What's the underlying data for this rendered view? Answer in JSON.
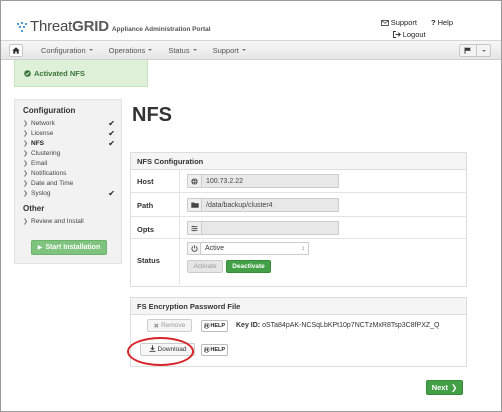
{
  "app": {
    "logo_text_light": "Threat",
    "logo_text_bold": "GRID",
    "subtitle": "Appliance Administration Portal"
  },
  "top_links": {
    "support": "Support",
    "help": "Help",
    "logout": "Logout"
  },
  "navbar": {
    "menus": [
      "Configuration",
      "Operations",
      "Status",
      "Support"
    ]
  },
  "alert": {
    "text": "Activated NFS",
    "color": "#dff0d8"
  },
  "sidebar": {
    "config_heading": "Configuration",
    "items": [
      {
        "label": "Network",
        "checked": true,
        "active": false
      },
      {
        "label": "License",
        "checked": true,
        "active": false
      },
      {
        "label": "NFS",
        "checked": true,
        "active": true
      },
      {
        "label": "Clustering",
        "checked": false,
        "active": false
      },
      {
        "label": "Email",
        "checked": false,
        "active": false
      },
      {
        "label": "Notifications",
        "checked": false,
        "active": false
      },
      {
        "label": "Date and Time",
        "checked": false,
        "active": false
      },
      {
        "label": "Syslog",
        "checked": true,
        "active": false
      }
    ],
    "other_heading": "Other",
    "other_items": [
      {
        "label": "Review and Install"
      }
    ],
    "start_button": "Start Installation"
  },
  "main": {
    "title": "NFS",
    "nfs_panel": {
      "heading": "NFS Configuration",
      "host_label": "Host",
      "host_value": "100.73.2.22",
      "path_label": "Path",
      "path_value": "/data/backup/cluster4",
      "opts_label": "Opts",
      "opts_value": "",
      "status_label": "Status",
      "status_value": "Active",
      "activate_label": "Activate",
      "deactivate_label": "Deactivate"
    },
    "fs_panel": {
      "heading": "FS Encryption Password File",
      "remove_label": "Remove",
      "help_label": "HELP",
      "key_id_label": "Key ID:",
      "key_id_value": "oSTa84pAK-NCSqLbKPt10p7NCTzMxR8Tsp3C8fPXZ_Q",
      "download_label": "Download",
      "help2_label": "HELP"
    },
    "next_label": "Next"
  },
  "colors": {
    "accent_green": "#43a047",
    "start_green": "#7ec37e",
    "highlight_red": "#d8232a"
  }
}
